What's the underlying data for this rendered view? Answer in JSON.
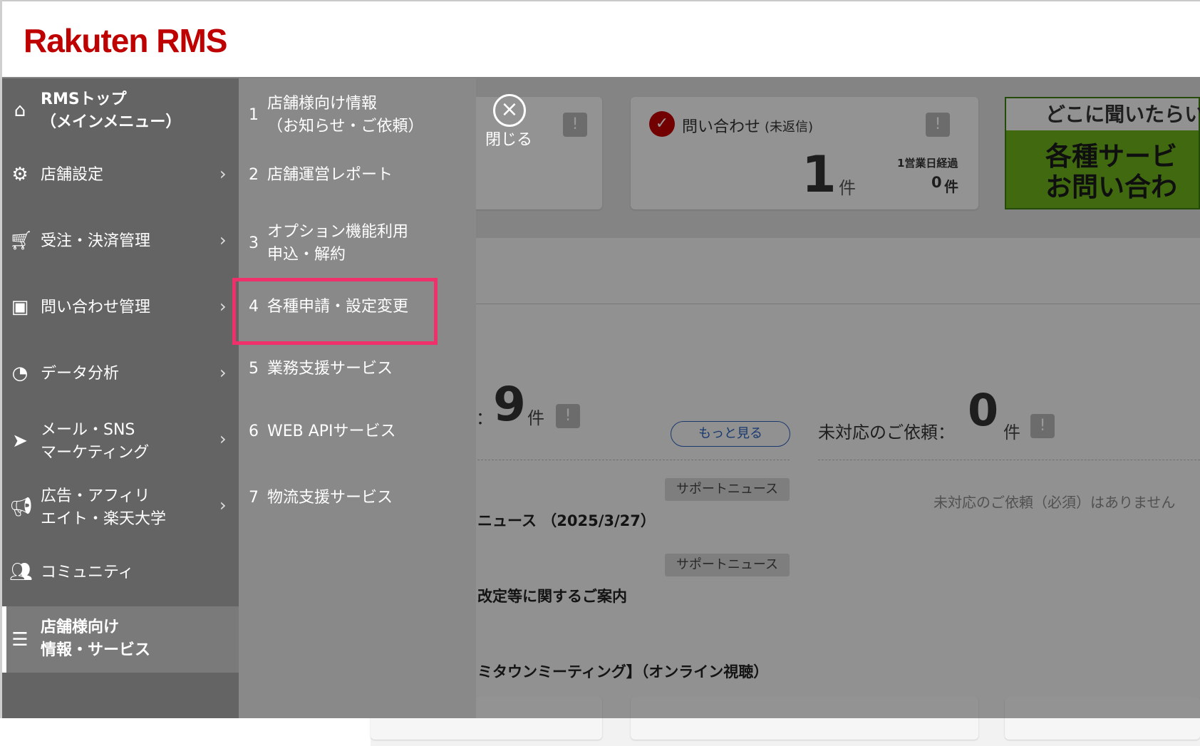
{
  "brand": {
    "logo": "Rakuten RMS",
    "color": "#bf0000"
  },
  "sidebar": {
    "items": [
      {
        "icon": "home-icon",
        "label": "RMSトップ\n（メインメニュー）",
        "chevron": false
      },
      {
        "icon": "gear-icon",
        "label": "店舗設定",
        "chevron": true
      },
      {
        "icon": "cart-icon",
        "label": "受注・決済管理",
        "chevron": true
      },
      {
        "icon": "chat-icon",
        "label": "問い合わせ管理",
        "chevron": true
      },
      {
        "icon": "pie-chart-icon",
        "label": "データ分析",
        "chevron": true
      },
      {
        "icon": "paper-plane-icon",
        "label": "メール・SNS\nマーケティング",
        "chevron": true
      },
      {
        "icon": "megaphone-icon",
        "label": "広告・アフィリ\nエイト・楽天大学",
        "chevron": true
      },
      {
        "icon": "people-icon",
        "label": "コミュニティ",
        "chevron": false
      },
      {
        "icon": "list-icon",
        "label": "店舗様向け\n情報・サービス",
        "chevron": false,
        "active": true
      }
    ]
  },
  "submenu": {
    "items": [
      {
        "num": "1",
        "label": "店舗様向け情報\n（お知らせ・ご依頼）"
      },
      {
        "num": "2",
        "label": "店舗運営レポート"
      },
      {
        "num": "3",
        "label": "オプション機能利用\n申込・解約"
      },
      {
        "num": "4",
        "label": "各種申請・設定変更",
        "highlighted": true
      },
      {
        "num": "5",
        "label": "業務支援サービス"
      },
      {
        "num": "6",
        "label": "WEB APIサービス"
      },
      {
        "num": "7",
        "label": "物流支援サービス"
      }
    ],
    "close_label": "閉じる"
  },
  "dashboard": {
    "inquiry_card": {
      "title": "問い合わせ",
      "title_sub": "(未返信)",
      "count": "1",
      "unit": "件",
      "elapsed_label": "1営業日経過",
      "elapsed_count": "0",
      "elapsed_unit": "件"
    },
    "banner": {
      "top": "どこに聞いたらい",
      "line1": "各種サービ",
      "line2": "お問い合わ"
    },
    "news": {
      "count_prefix": "：",
      "count": "9",
      "unit": "件",
      "more_button": "もっと見る",
      "items": [
        {
          "tag": "サポートニュース",
          "title": "ニュース （2025/3/27）"
        },
        {
          "tag": "サポートニュース",
          "title": "改定等に関するご案内"
        },
        {
          "tag": "",
          "title": "ミタウンミーティング】（オンライン視聴）"
        }
      ]
    },
    "requests": {
      "label": "未対応のご依頼：",
      "count": "0",
      "unit": "件",
      "empty_text": "未対応のご依頼（必須）はありません"
    }
  },
  "colors": {
    "highlight": "#f0306a",
    "sidebar": "#646464",
    "submenu": "#898989",
    "link": "#2a5fb8"
  }
}
